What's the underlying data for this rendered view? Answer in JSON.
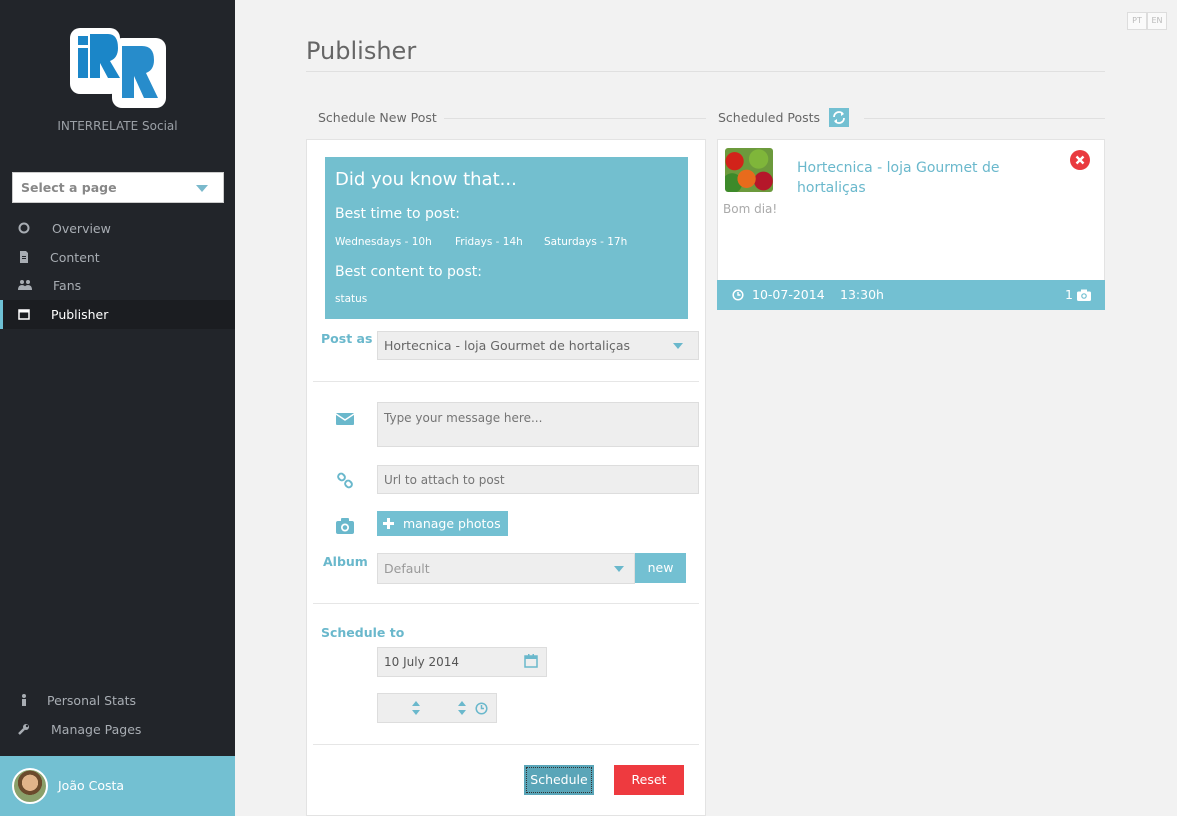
{
  "lang": {
    "pt": "PT",
    "en": "EN"
  },
  "sidebar": {
    "brand": "INTERRELATE Social",
    "page_select": "Select a page",
    "items": [
      {
        "label": "Overview",
        "icon": "circle-o-icon"
      },
      {
        "label": "Content",
        "icon": "file-icon"
      },
      {
        "label": "Fans",
        "icon": "users-icon"
      },
      {
        "label": "Publisher",
        "icon": "calendar-icon",
        "active": true
      }
    ],
    "bottom_items": [
      {
        "label": "Personal Stats",
        "icon": "person-icon"
      },
      {
        "label": "Manage Pages",
        "icon": "wrench-icon"
      }
    ],
    "user": {
      "name": "João Costa"
    }
  },
  "main": {
    "title": "Publisher",
    "schedule_new_post": "Schedule New Post",
    "scheduled_posts": "Scheduled Posts"
  },
  "tip": {
    "heading": "Did you know that...",
    "best_time_label": "Best time to post:",
    "times": [
      "Wednesdays - 10h",
      "Fridays - 14h",
      "Saturdays - 17h"
    ],
    "best_content_label": "Best content to post:",
    "content": "status"
  },
  "form": {
    "post_as_label": "Post as",
    "post_as_value": "Hortecnica - loja Gourmet de hortaliças",
    "message_placeholder": "Type your message here...",
    "url_placeholder": "Url to attach to post",
    "manage_photos": "manage photos",
    "album_label": "Album",
    "album_value": "Default",
    "new_button": "new",
    "schedule_to_label": "Schedule to",
    "date_value": "10 July 2014",
    "schedule_button": "Schedule",
    "reset_button": "Reset"
  },
  "scheduled": [
    {
      "page": "Hortecnica - loja Gourmet de hortaliças",
      "message": "Bom dia!",
      "date": "10-07-2014",
      "time": "13:30h",
      "photos": "1"
    }
  ],
  "colors": {
    "accent": "#73c0d2",
    "danger": "#ee3a3f",
    "sidebar": "#22252a"
  }
}
